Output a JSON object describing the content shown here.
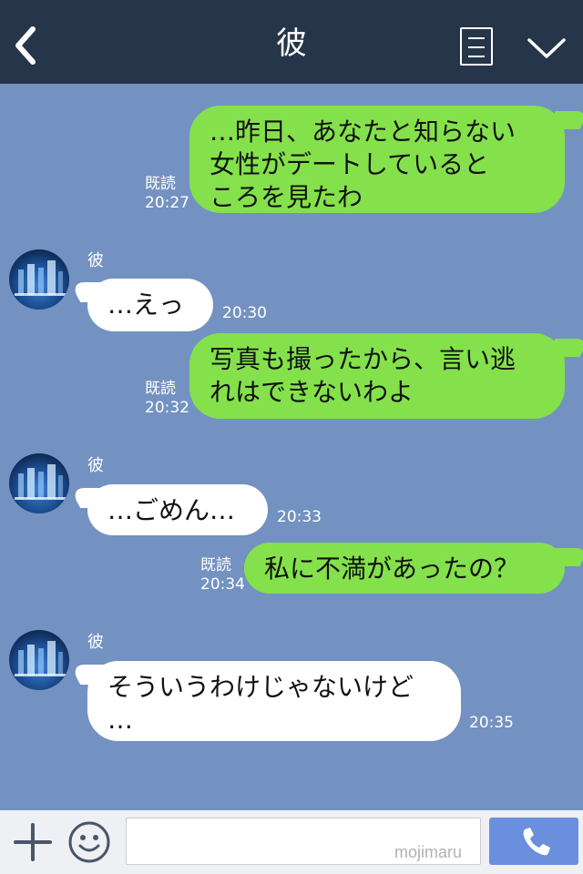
{
  "header": {
    "title": "彼"
  },
  "messages": [
    {
      "side": "out",
      "text_lines": [
        "…昨日、あなたと知らない",
        "女性がデートしていると",
        "ころを見たわ"
      ],
      "read": "既読",
      "time": "20:27"
    },
    {
      "side": "in",
      "sender": "彼",
      "text_lines": [
        "…えっ"
      ],
      "time": "20:30"
    },
    {
      "side": "out",
      "text_lines": [
        "写真も撮ったから、言い逃",
        "れはできないわよ"
      ],
      "read": "既読",
      "time": "20:32"
    },
    {
      "side": "in",
      "sender": "彼",
      "text_lines": [
        "…ごめん…"
      ],
      "time": "20:33"
    },
    {
      "side": "out",
      "text_lines": [
        "私に不満があったの？"
      ],
      "read": "既読",
      "time": "20:34"
    },
    {
      "side": "in",
      "sender": "彼",
      "text_lines": [
        "そういうわけじゃないけど",
        "…"
      ],
      "time": "20:35"
    }
  ],
  "footer": {
    "input_value": "",
    "watermark": "mojimaru"
  },
  "colors": {
    "header": "#263549",
    "background": "#7392c1",
    "bubble_out": "#84e14b",
    "bubble_in": "#ffffff",
    "call_button": "#6a8fdd"
  },
  "icons": {
    "back": "chevron-left-icon",
    "menu": "list-icon",
    "collapse": "chevron-down-icon",
    "add": "plus-icon",
    "emoji": "smiley-icon",
    "call": "phone-icon"
  }
}
